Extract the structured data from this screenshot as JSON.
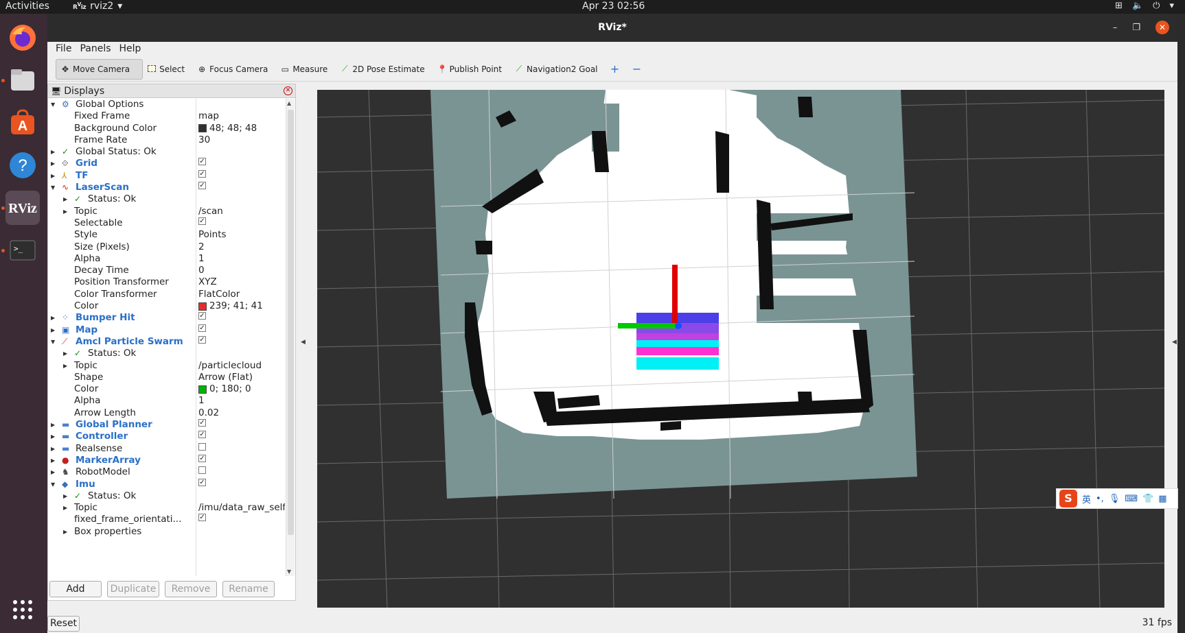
{
  "topbar": {
    "activities": "Activities",
    "app_name": "rviz2",
    "clock": "Apr 23  02:56"
  },
  "window": {
    "title": "RViz*"
  },
  "menu": [
    "File",
    "Panels",
    "Help"
  ],
  "toolbar": {
    "tools": [
      {
        "label": "Move Camera",
        "icon": "move-camera-icon"
      },
      {
        "label": "Select",
        "icon": "select-icon"
      },
      {
        "label": "Focus Camera",
        "icon": "focus-camera-icon"
      },
      {
        "label": "Measure",
        "icon": "measure-icon"
      },
      {
        "label": "2D Pose Estimate",
        "icon": "pose-estimate-icon"
      },
      {
        "label": "Publish Point",
        "icon": "publish-point-icon"
      },
      {
        "label": "Navigation2 Goal",
        "icon": "nav-goal-icon"
      }
    ]
  },
  "displays": {
    "title": "Displays",
    "rows": [
      {
        "depth": 0,
        "arrow": "open",
        "icon": "gear-icon",
        "name": "Global Options",
        "display": false
      },
      {
        "depth": 1,
        "name": "Fixed Frame",
        "value": "map"
      },
      {
        "depth": 1,
        "name": "Background Color",
        "value": "48; 48; 48",
        "swatch": "#303030"
      },
      {
        "depth": 1,
        "name": "Frame Rate",
        "value": "30"
      },
      {
        "depth": 0,
        "arrow": "closed",
        "icon": "check-icon",
        "name": "Global Status: Ok",
        "display": false
      },
      {
        "depth": 0,
        "arrow": "closed",
        "icon": "grid-icon",
        "name": "Grid",
        "display": true,
        "checked": true
      },
      {
        "depth": 0,
        "arrow": "closed",
        "icon": "tf-icon",
        "name": "TF",
        "display": true,
        "checked": true
      },
      {
        "depth": 0,
        "arrow": "open",
        "icon": "laserscan-icon",
        "name": "LaserScan",
        "display": true,
        "checked": true
      },
      {
        "depth": 1,
        "arrow": "closed",
        "icon": "check-icon",
        "name": "Status: Ok"
      },
      {
        "depth": 1,
        "arrow": "closed",
        "name": "Topic",
        "value": "/scan"
      },
      {
        "depth": 1,
        "name": "Selectable",
        "checked": true
      },
      {
        "depth": 1,
        "name": "Style",
        "value": "Points"
      },
      {
        "depth": 1,
        "name": "Size (Pixels)",
        "value": "2"
      },
      {
        "depth": 1,
        "name": "Alpha",
        "value": "1"
      },
      {
        "depth": 1,
        "name": "Decay Time",
        "value": "0"
      },
      {
        "depth": 1,
        "name": "Position Transformer",
        "value": "XYZ"
      },
      {
        "depth": 1,
        "name": "Color Transformer",
        "value": "FlatColor"
      },
      {
        "depth": 1,
        "name": "Color",
        "value": "239; 41; 41",
        "swatch": "#ef2929"
      },
      {
        "depth": 0,
        "arrow": "closed",
        "icon": "bumper-icon",
        "name": "Bumper Hit",
        "display": true,
        "checked": true
      },
      {
        "depth": 0,
        "arrow": "closed",
        "icon": "map-icon",
        "name": "Map",
        "display": true,
        "checked": true
      },
      {
        "depth": 0,
        "arrow": "open",
        "icon": "particle-icon",
        "name": "Amcl Particle Swarm",
        "display": true,
        "checked": true
      },
      {
        "depth": 1,
        "arrow": "closed",
        "icon": "check-icon",
        "name": "Status: Ok"
      },
      {
        "depth": 1,
        "arrow": "closed",
        "name": "Topic",
        "value": "/particlecloud"
      },
      {
        "depth": 1,
        "name": "Shape",
        "value": "Arrow (Flat)"
      },
      {
        "depth": 1,
        "name": "Color",
        "value": "0; 180; 0",
        "swatch": "#00b400"
      },
      {
        "depth": 1,
        "name": "Alpha",
        "value": "1"
      },
      {
        "depth": 1,
        "name": "Arrow Length",
        "value": "0.02"
      },
      {
        "depth": 0,
        "arrow": "closed",
        "icon": "folder-icon",
        "name": "Global Planner",
        "display": true,
        "checked": true
      },
      {
        "depth": 0,
        "arrow": "closed",
        "icon": "folder-icon",
        "name": "Controller",
        "display": true,
        "checked": true
      },
      {
        "depth": 0,
        "arrow": "closed",
        "icon": "folder-icon",
        "name": "Realsense",
        "display": false,
        "checked": false
      },
      {
        "depth": 0,
        "arrow": "closed",
        "icon": "marker-icon",
        "name": "MarkerArray",
        "display": true,
        "checked": true
      },
      {
        "depth": 0,
        "arrow": "closed",
        "icon": "robot-icon",
        "name": "RobotModel",
        "display": false,
        "checked": false
      },
      {
        "depth": 0,
        "arrow": "open",
        "icon": "imu-icon",
        "name": "Imu",
        "display": true,
        "checked": true
      },
      {
        "depth": 1,
        "arrow": "closed",
        "icon": "check-icon",
        "name": "Status: Ok"
      },
      {
        "depth": 1,
        "arrow": "closed",
        "name": "Topic",
        "value": "/imu/data_raw_self"
      },
      {
        "depth": 1,
        "name": "fixed_frame_orientati...",
        "checked": true
      },
      {
        "depth": 1,
        "arrow": "closed",
        "name": "Box properties"
      }
    ],
    "buttons": [
      {
        "label": "Add",
        "enabled": true
      },
      {
        "label": "Duplicate",
        "enabled": false
      },
      {
        "label": "Remove",
        "enabled": false
      },
      {
        "label": "Rename",
        "enabled": false
      }
    ]
  },
  "footer": {
    "reset": "Reset",
    "fps": "31 fps"
  },
  "ime": {
    "lang": "英"
  },
  "colors": {
    "background": "#303030",
    "laser": "#ef2929",
    "particles": "#00b400",
    "accent": "#e95420",
    "display_blue": "#2a6fc9"
  }
}
